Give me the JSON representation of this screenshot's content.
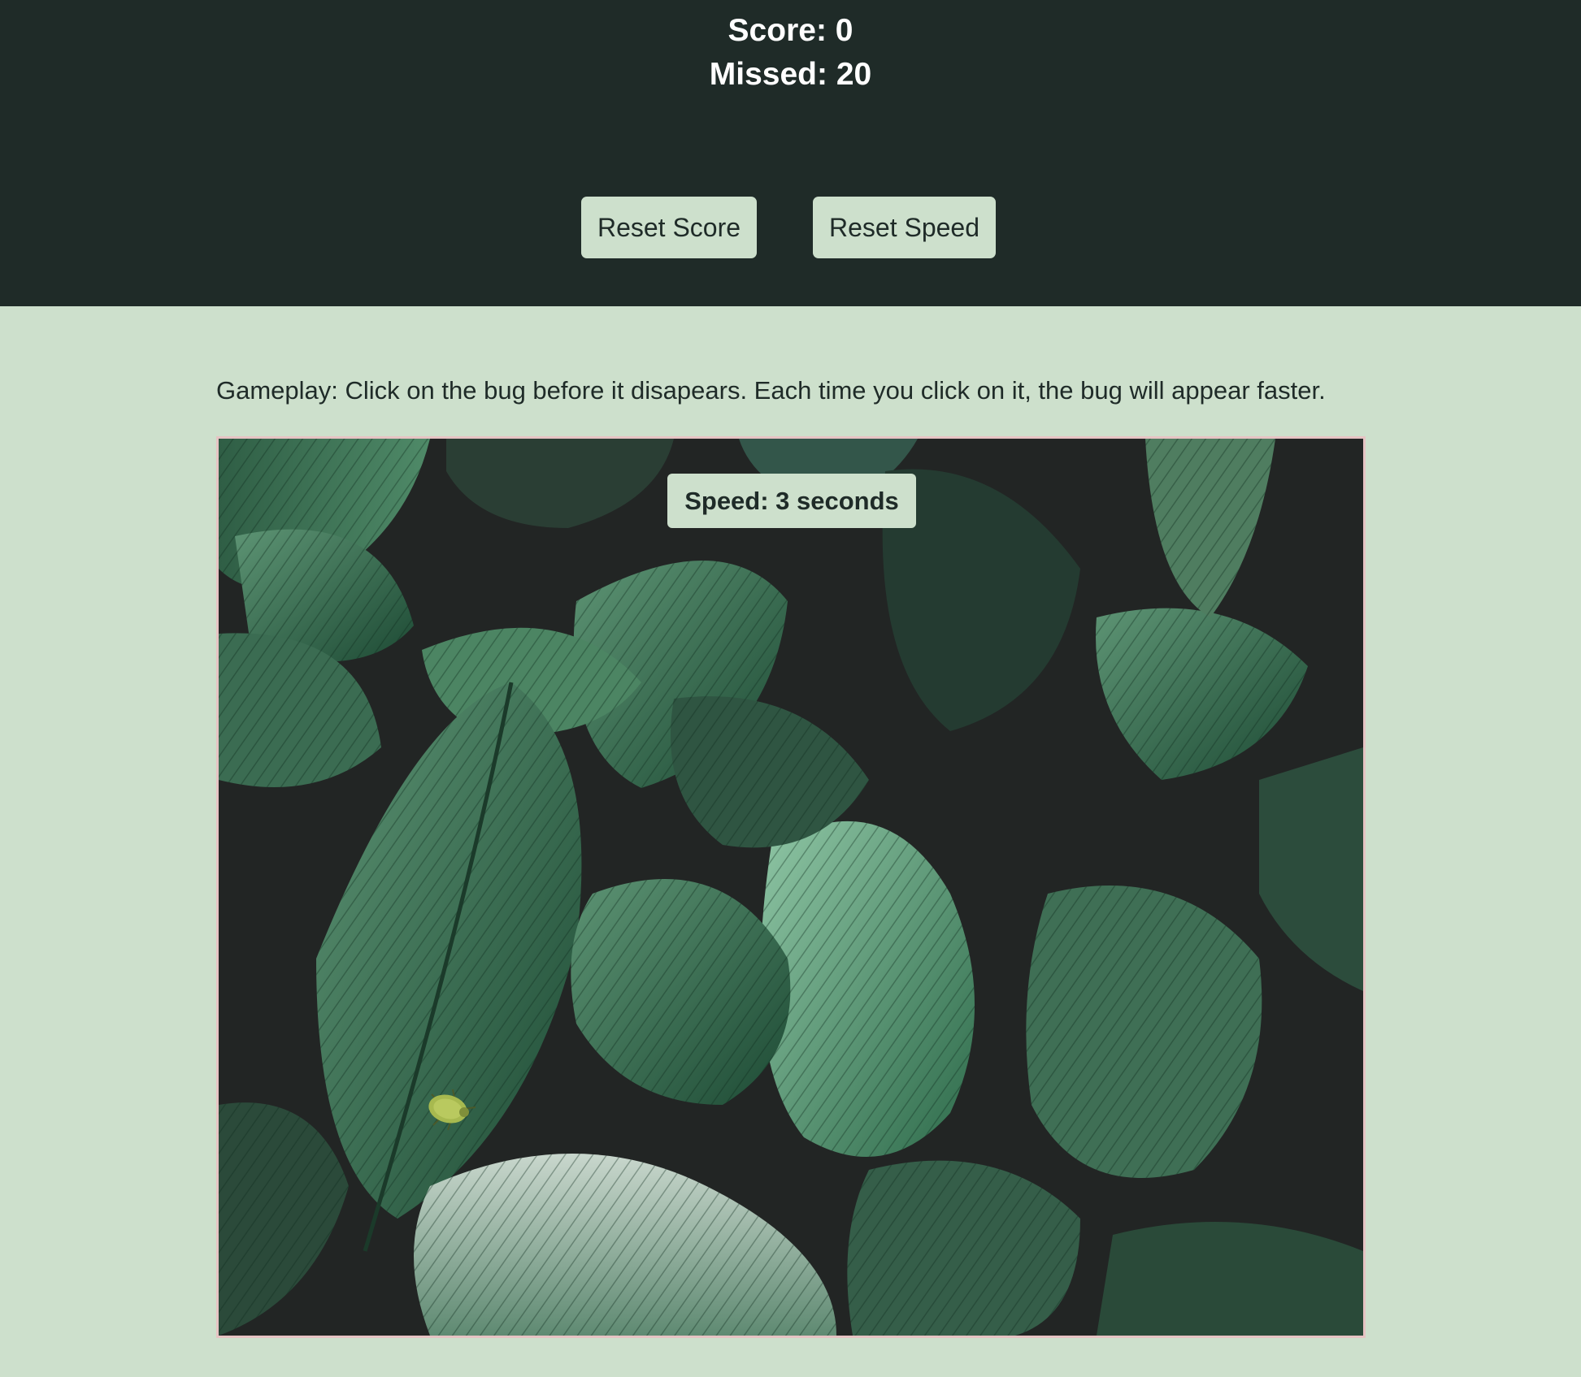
{
  "header": {
    "score_text": "Score: 0",
    "missed_text": "Missed: 20",
    "reset_score_label": "Reset Score",
    "reset_speed_label": "Reset Speed"
  },
  "game": {
    "instructions": "Gameplay: Click on the bug before it disapears. Each time you click on it, the bug will appear faster.",
    "speed_text": "Speed: 3 seconds",
    "score": 0,
    "missed": 20,
    "speed_seconds": 3,
    "background_image": "tropical-leaves",
    "bug_icon": "bug-icon"
  },
  "colors": {
    "header_bg": "#1f2b28",
    "page_bg": "#cde0cc",
    "button_bg": "#cde0cc",
    "text_dark": "#1f2b28",
    "text_light": "#ffffff",
    "game_border": "#e6c3c3"
  }
}
